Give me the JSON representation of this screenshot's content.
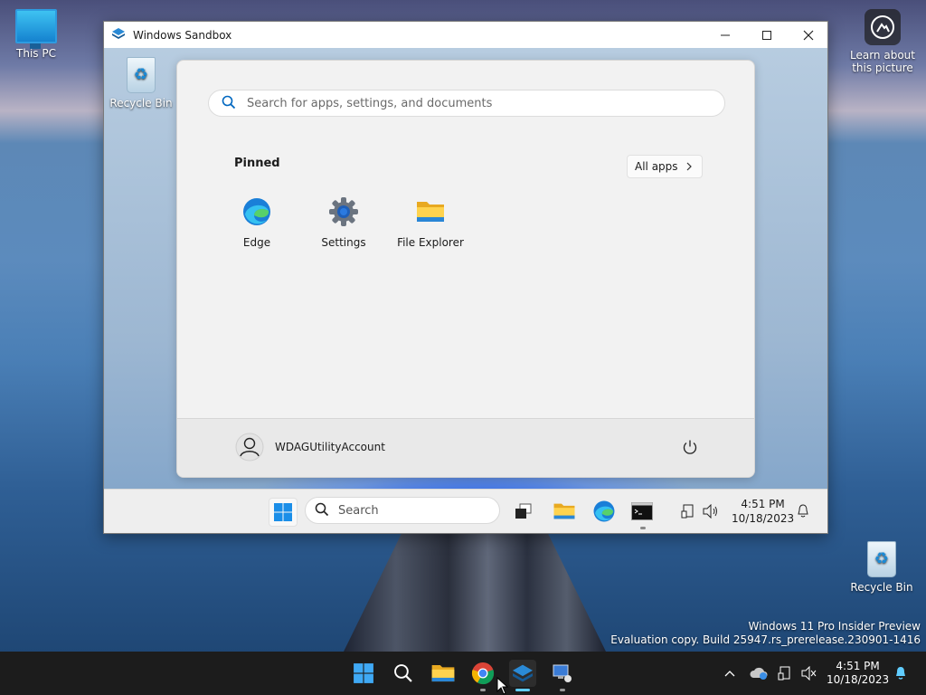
{
  "desktop": {
    "icons": {
      "this_pc": "This PC",
      "recycle_bin": "Recycle Bin"
    },
    "learn_about": "Learn about this picture",
    "watermark": {
      "line1": "Windows 11 Pro Insider Preview",
      "line2": "Evaluation copy. Build 25947.rs_prerelease.230901-1416"
    }
  },
  "sandbox_window": {
    "title": "Windows Sandbox",
    "desktop_icon": "Recycle Bin",
    "start_menu": {
      "search_placeholder": "Search for apps, settings, and documents",
      "pinned_label": "Pinned",
      "all_apps_label": "All apps",
      "pinned_apps": [
        {
          "label": "Edge",
          "icon": "edge-icon"
        },
        {
          "label": "Settings",
          "icon": "settings-gear-icon"
        },
        {
          "label": "File Explorer",
          "icon": "folder-icon"
        }
      ],
      "user_name": "WDAGUtilityAccount"
    },
    "taskbar": {
      "search_label": "Search",
      "time": "4:51 PM",
      "date": "10/18/2023"
    }
  },
  "host_taskbar": {
    "time": "4:51 PM",
    "date": "10/18/2023"
  },
  "colors": {
    "accent": "#0078d4",
    "host_taskbar_bg": "#1c1c1c",
    "sandbox_taskbar_bg": "#eeeeee"
  }
}
